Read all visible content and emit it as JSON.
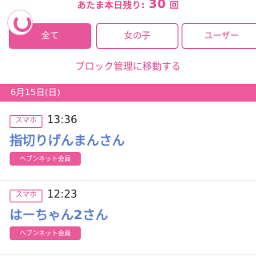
{
  "header": {
    "counter_prefix": "あたま本日残り:",
    "counter_value": "30",
    "counter_suffix": "回"
  },
  "tabs": [
    {
      "label": "全て",
      "active": true
    },
    {
      "label": "女の子",
      "active": false
    },
    {
      "label": "ユーザー",
      "active": false
    }
  ],
  "block_link_label": "ブロック管理に移動する",
  "date_header": "6月15日(日)",
  "entries": [
    {
      "device": "スマホ",
      "time": "13:36",
      "name": "指切りげんまんさん",
      "member_badge": "ヘブンネット会員"
    },
    {
      "device": "スマホ",
      "time": "12:23",
      "name": "はーちゃん2さん",
      "member_badge": "ヘブンネット会員"
    }
  ],
  "colors": {
    "accent": "#e9559a",
    "name": "#5a7fd0"
  }
}
